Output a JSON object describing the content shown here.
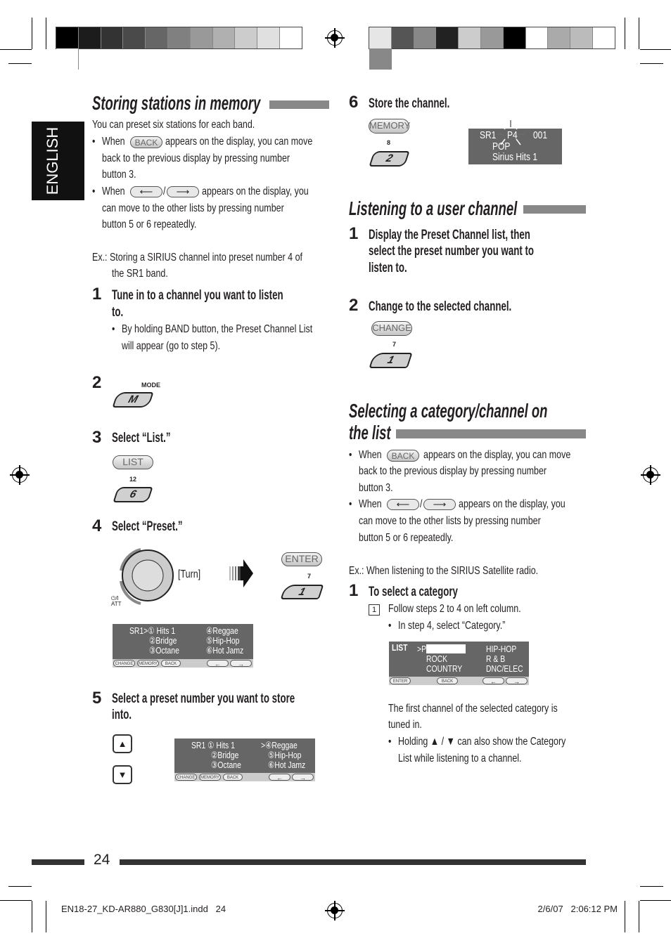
{
  "print_marks": {
    "left_swatches": [
      "#000000",
      "#1c1c1c",
      "#333333",
      "#4a4a4a",
      "#666666",
      "#808080",
      "#999999",
      "#b0b0b0",
      "#cccccc",
      "#e0e0e0",
      "#ffffff"
    ],
    "right_swatches": [
      "#e6e6e6",
      "#555555",
      "#888888",
      "#222222",
      "#cccccc",
      "#999999",
      "#000000",
      "#ffffff",
      "#aaaaaa",
      "#bbbbbb",
      "#888888"
    ],
    "slug_file": "EN18-27_KD-AR880_G830[J]1.indd   24",
    "slug_date": "2/6/07   2:06:12 PM"
  },
  "side_tab": "ENGLISH",
  "page_number": "24",
  "left": {
    "title": "Storing stations in memory",
    "intro": "You can preset six stations for each band.",
    "bullet1": {
      "when": "When",
      "pill": "BACK",
      "l1": "appears on the display, you can move",
      "l2": "back to the previous display by pressing number",
      "l3": "button 3."
    },
    "bullet2": {
      "when": "When",
      "sep": "/",
      "l1": "appears on the display, you",
      "l2": "can move to the other lists by pressing number",
      "l3": "button 5 or 6 repeatedly."
    },
    "example": {
      "l1": "Ex.:  Storing a SIRIUS channel into preset number 4 of",
      "l2": "the SR1 band."
    },
    "step1": {
      "num": "1",
      "l1": "Tune in to a channel you want to listen",
      "l2": "to.",
      "note1": "By holding BAND button, the Preset Channel List",
      "note2": "will appear (go to step 5)."
    },
    "step2": {
      "num": "2",
      "label": "MODE",
      "button": "M"
    },
    "step3": {
      "num": "3",
      "text": "Select “List.”",
      "pill": "LIST",
      "label": "12",
      "button": "6"
    },
    "step4": {
      "num": "4",
      "text": "Select “Preset.”",
      "turn": "[Turn]",
      "att": "⏻/I ATT",
      "pill": "ENTER",
      "label": "7",
      "button": "1"
    },
    "display1": {
      "r1c1": "SR1>① Hits 1",
      "r1c2": "④Reggae",
      "r2c1": "②Bridge",
      "r2c2": "⑤Hip-Hop",
      "r3c1": "③Octane",
      "r3c2": "⑥Hot Jamz",
      "b1": "CHANGE",
      "b2": "MEMORY",
      "b3": "BACK"
    },
    "step5": {
      "num": "5",
      "l1": "Select a preset number you want to store",
      "l2": "into.",
      "up": "▲",
      "down": "▼"
    },
    "display2": {
      "r1c1": "SR1  ① Hits 1",
      "r1c2": ">④Reggae",
      "r2c1": "②Bridge",
      "r2c2": "⑤Hip-Hop",
      "r3c1": "③Octane",
      "r3c2": "⑥Hot Jamz",
      "b1": "CHANGE",
      "b2": "MEMORY",
      "b3": "BACK"
    }
  },
  "right": {
    "step6": {
      "num": "6",
      "text": "Store the channel.",
      "pill": "MEMORY",
      "label": "8",
      "button": "2",
      "d1": "SR1",
      "d2": "P4",
      "d3": "001",
      "d4": "POP",
      "d5": "Sirius Hits 1"
    },
    "title2": "Listening to a user channel",
    "l_step1": {
      "num": "1",
      "l1": "Display the Preset Channel list, then",
      "l2": "select the preset number you want to",
      "l3": "listen to."
    },
    "l_step2": {
      "num": "2",
      "text": "Change to the selected channel.",
      "pill": "CHANGE",
      "label": "7",
      "button": "1"
    },
    "title3a": "Selecting a category/channel on",
    "title3b": "the list",
    "bullet1": {
      "when": "When",
      "pill": "BACK",
      "l1": "appears on the display, you can move",
      "l2": "back to the previous display by pressing number",
      "l3": "button 3."
    },
    "bullet2": {
      "when": "When",
      "sep": "/",
      "l1": "appears on the display, you",
      "l2": "can move to the other lists by pressing number",
      "l3": "button 5 or 6 repeatedly."
    },
    "example": "Ex.:  When listening to the SIRIUS Satellite radio.",
    "s_step1": {
      "num": "1",
      "text": "To select a category",
      "box": "1",
      "follow": "Follow steps 2 to 4 on left column.",
      "note": "In step 4, select “Category.”"
    },
    "display3": {
      "list": "LIST",
      "r1c1": ">POP",
      "r1c2": "HIP-HOP",
      "r2c1": "ROCK",
      "r2c2": "R & B",
      "r3c1": "COUNTRY",
      "r3c2": "DNC/ELEC",
      "b1": "ENTER",
      "b2": "BACK"
    },
    "after1": "The first channel of the selected category is",
    "after2": "tuned in.",
    "hold1": "Holding ▲ / ▼ can also show the Category",
    "hold2": "List while listening to a channel."
  }
}
